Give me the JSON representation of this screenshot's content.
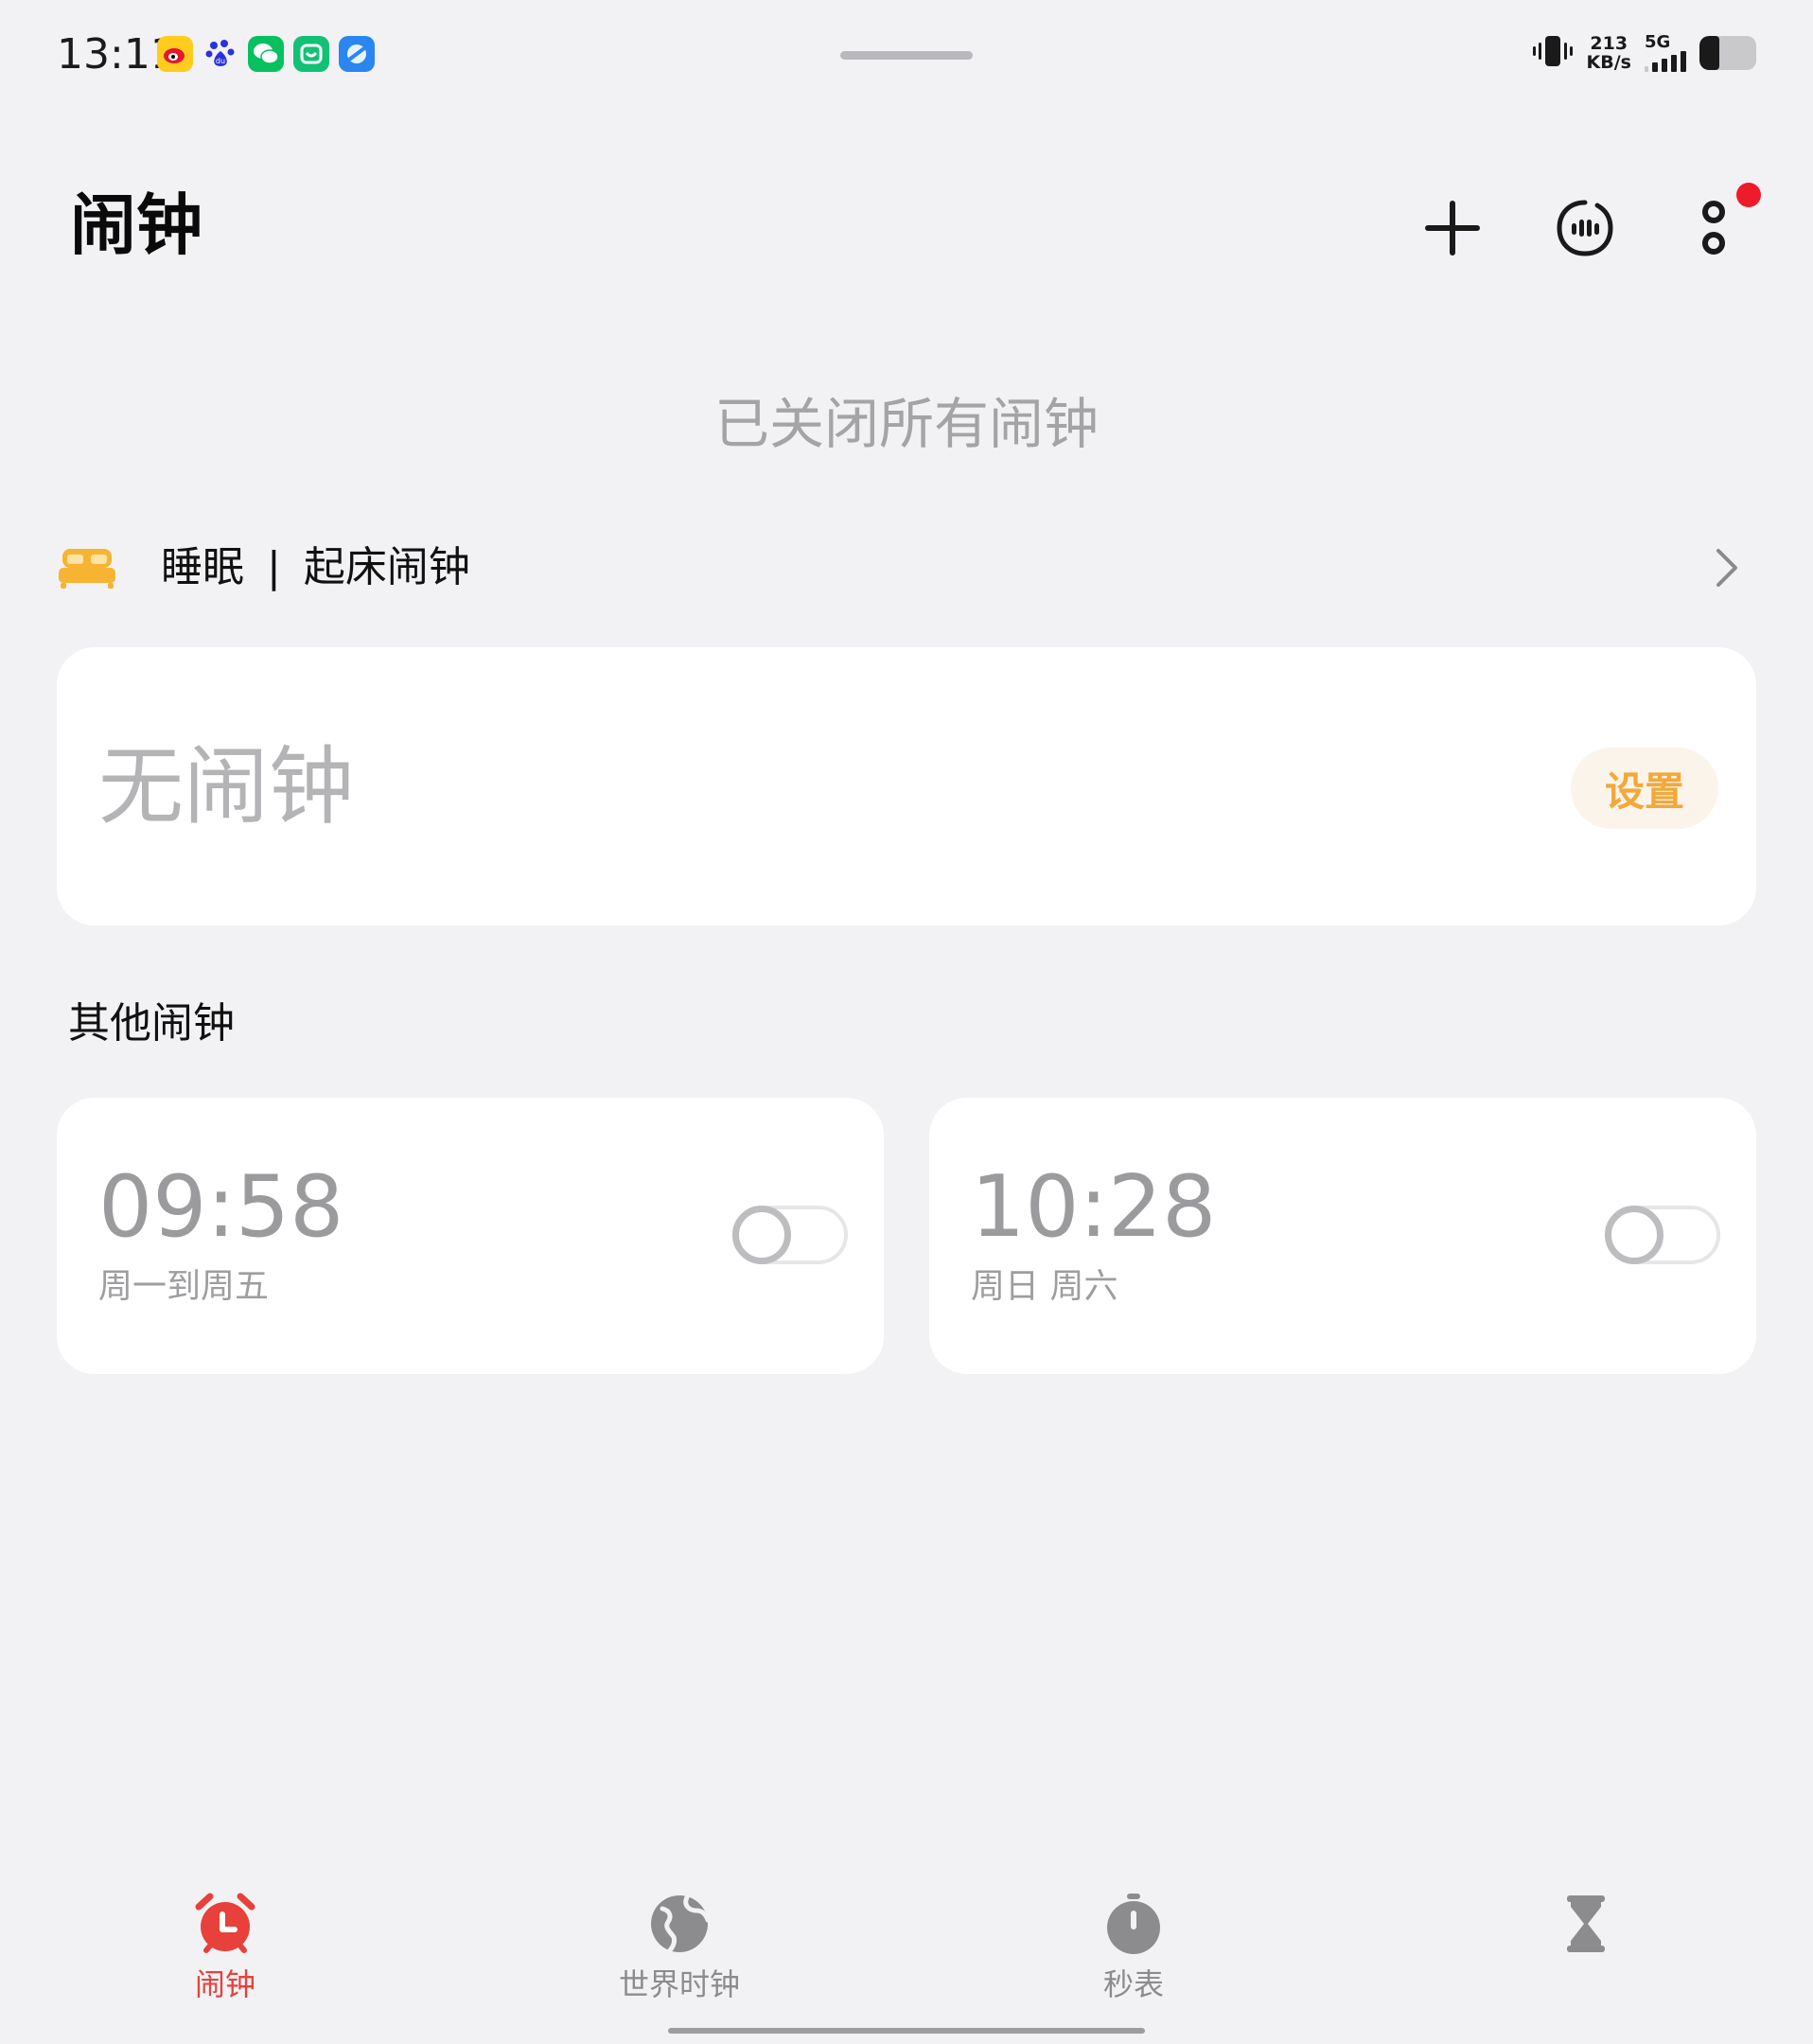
{
  "status_bar": {
    "time": "13:11",
    "notification_icons": [
      "weibo-icon",
      "baidu-icon",
      "wechat-icon",
      "message-icon",
      "browser-icon"
    ],
    "net_speed_value": "213",
    "net_speed_unit": "KB/s",
    "network": "5G",
    "battery_level": 0.35
  },
  "header": {
    "title": "闹钟",
    "actions": [
      "add-icon",
      "insight-icon",
      "more-icon"
    ],
    "has_notification_dot": true
  },
  "closed_note": "已关闭所有闹钟",
  "sleep": {
    "part1": "睡眠",
    "separator": "|",
    "part2": "起床闹钟"
  },
  "no_alarm_card": {
    "text": "无闹钟",
    "button": "设置"
  },
  "other_alarms": {
    "title": "其他闹钟",
    "items": [
      {
        "time": "09:58",
        "days": "周一到周五",
        "enabled": false
      },
      {
        "time": "10:28",
        "days": "周日 周六",
        "enabled": false
      }
    ]
  },
  "nav": {
    "items": [
      {
        "label": "闹钟",
        "icon": "alarm-clock-icon",
        "active": true
      },
      {
        "label": "世界时钟",
        "icon": "globe-icon",
        "active": false
      },
      {
        "label": "秒表",
        "icon": "stopwatch-icon",
        "active": false
      },
      {
        "label": "",
        "icon": "hourglass-icon",
        "active": false
      }
    ]
  },
  "colors": {
    "accent_active": "#e8403a",
    "set_button_text": "#f2a83a",
    "bed_icon": "#f7b433",
    "notification_dot": "#ee1c2a"
  }
}
